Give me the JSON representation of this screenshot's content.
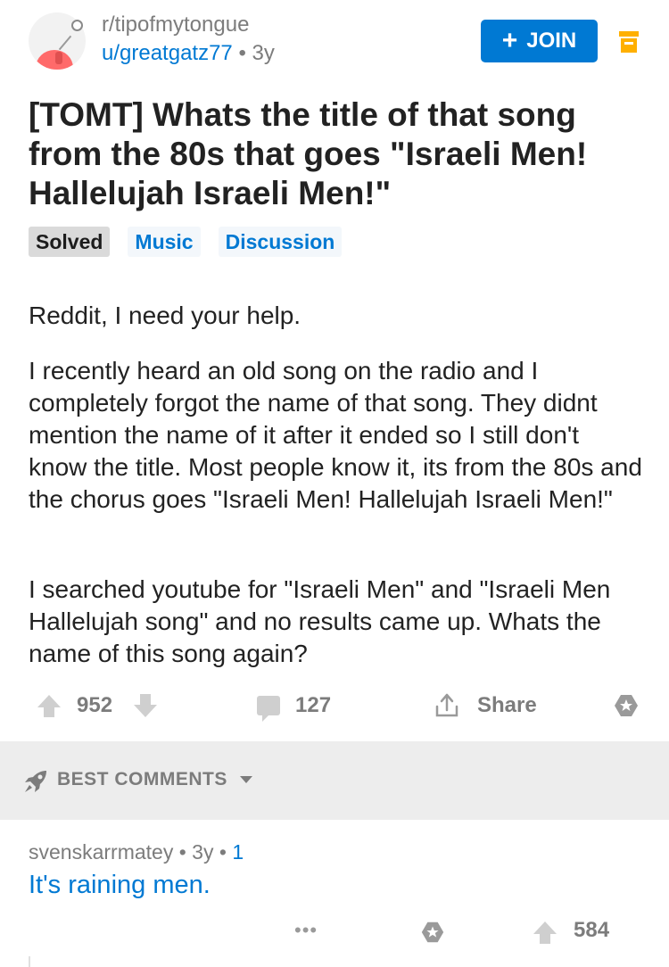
{
  "post": {
    "subreddit": "r/tipofmytongue",
    "author": "u/greatgatz77",
    "separator": "•",
    "age": "3y",
    "join_label": "JOIN",
    "join_plus": "+",
    "title": "[TOMT] Whats the title of that song from the 80s that goes \"Israeli Men! Hallelujah Israeli Men!\"",
    "flairs": [
      "Solved",
      "Music",
      "Discussion"
    ],
    "body": [
      "Reddit, I need your help.",
      "I recently heard an old song on the radio and I completely forgot the name of that song. They didnt mention the name of it after it ended so I still don't know the title. Most people know it, its from the 80s and the chorus goes \"Israeli Men! Hallelujah Israeli Men!\"",
      "I searched youtube for \"Israeli Men\" and \"Israeli Men Hallelujah song\" and no results came up. Whats the name of this song again?"
    ],
    "score": "952",
    "comments": "127",
    "share_label": "Share"
  },
  "comments_section": {
    "sort_label": "BEST COMMENTS"
  },
  "comment": {
    "author": "svenskarrmatey",
    "separator": "•",
    "age": "3y",
    "reply_count": "1",
    "text": "It's raining men.",
    "more": "•••",
    "score": "584"
  },
  "colors": {
    "accent": "#0079d3",
    "muted": "#7c7c7c",
    "saved": "#ffb000",
    "section_bg": "#ededed"
  },
  "icons": [
    "avatar-snoo-icon",
    "plus-icon",
    "saved-icon",
    "upvote-icon",
    "downvote-icon",
    "comment-icon",
    "share-icon",
    "award-icon",
    "rocket-icon",
    "chevron-down-icon"
  ]
}
